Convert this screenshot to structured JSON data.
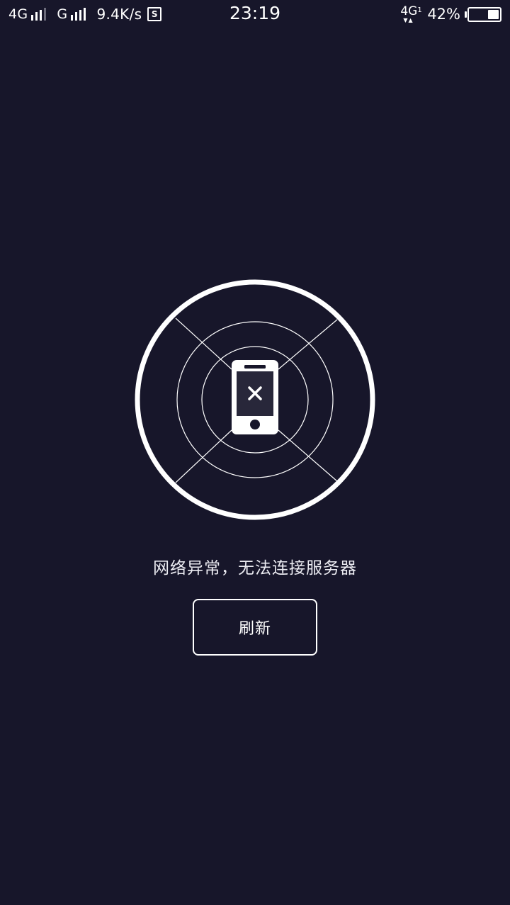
{
  "status_bar": {
    "sim1_network": "4G",
    "sim2_network": "G",
    "speed": "9.4K/s",
    "sd_glyph": "S",
    "time": "23:19",
    "data_network": "4G",
    "data_network_sub": "1",
    "battery_percent": "42%",
    "battery_level": 0.42,
    "icons": [
      "signal-icon",
      "signal-icon",
      "sd-card-icon",
      "data-activity-icon",
      "battery-icon"
    ]
  },
  "main": {
    "illustration_icon": "phone-disconnected-icon",
    "error_message": "网络异常，无法连接服务器",
    "refresh_label": "刷新"
  },
  "colors": {
    "background": "#17162a",
    "foreground": "#ffffff"
  }
}
